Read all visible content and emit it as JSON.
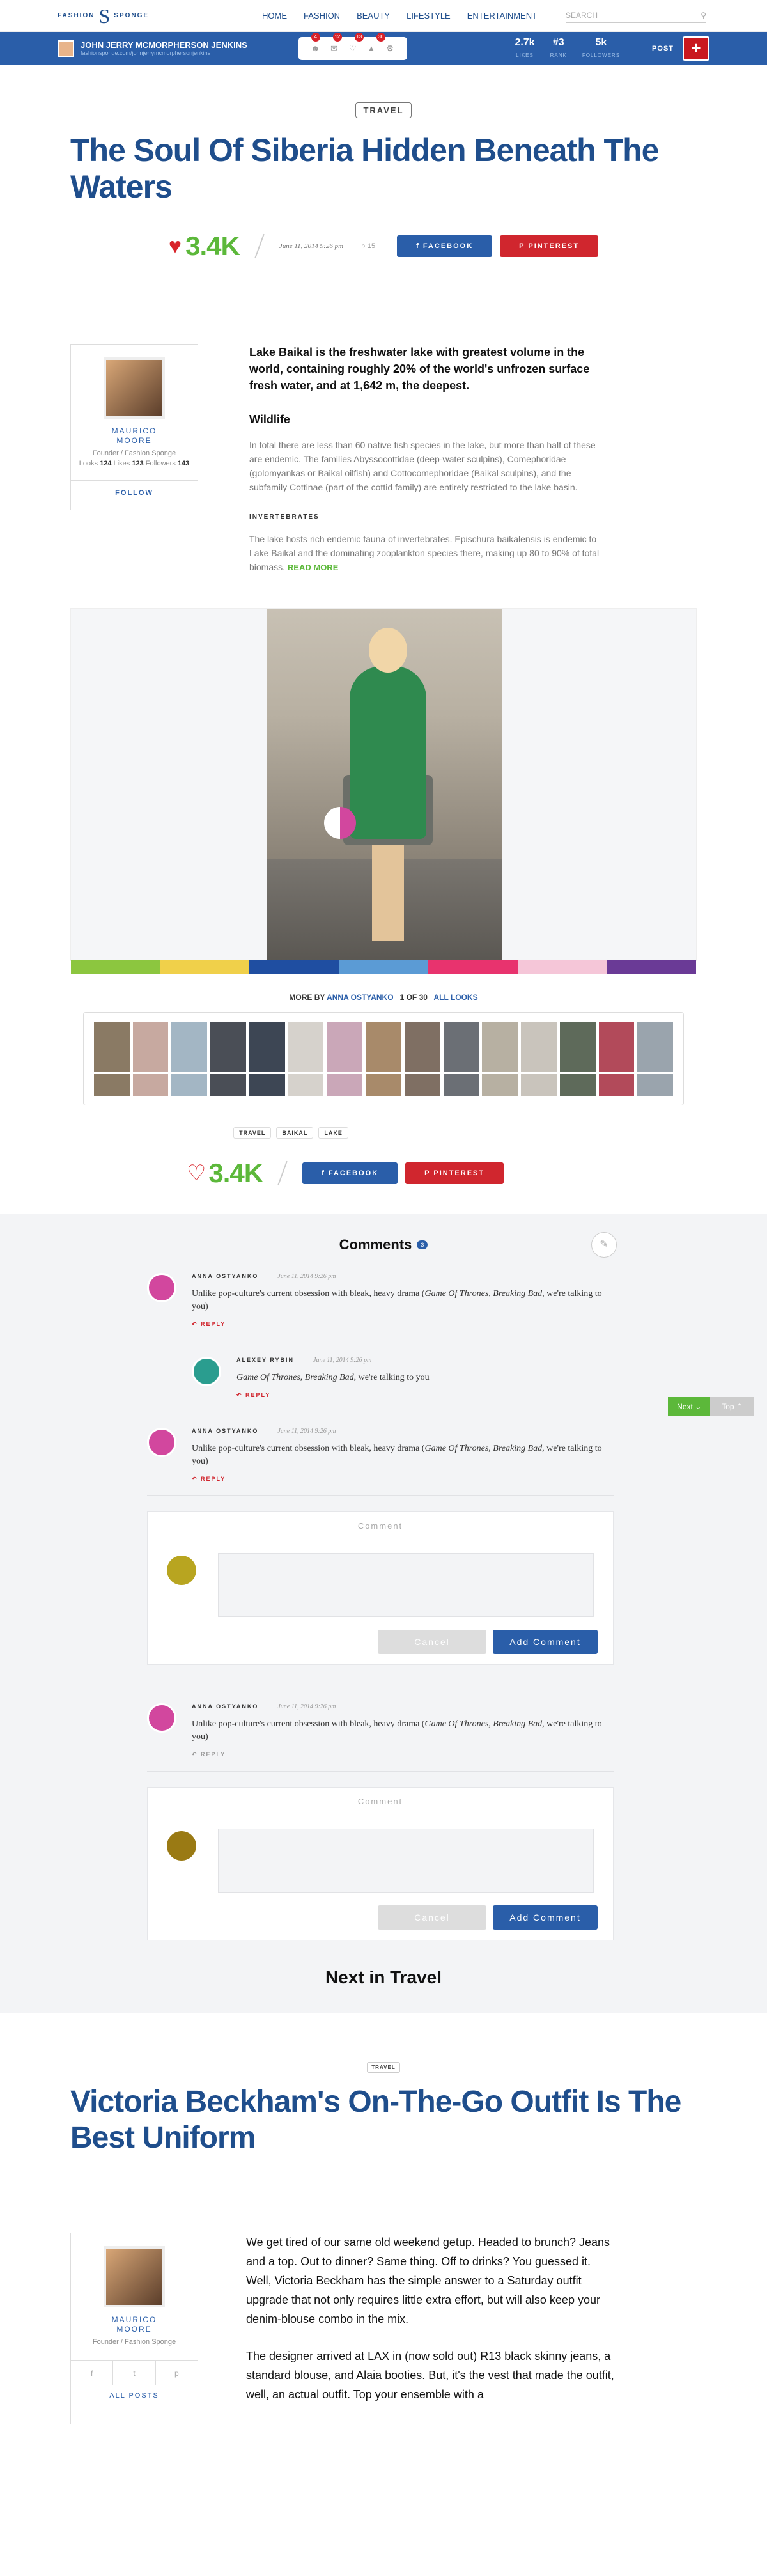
{
  "brand": {
    "left": "FASHION",
    "right": "SPONGE",
    "mark": "S"
  },
  "nav": {
    "items": [
      "HOME",
      "FASHION",
      "BEAUTY",
      "LIFESTYLE",
      "ENTERTAINMENT"
    ],
    "search_placeholder": "SEARCH"
  },
  "user": {
    "name": "JOHN JERRY MCMORPHERSON JENKINS",
    "url": "fashionsponge.com/johnjerrymcmorphersonjenkins",
    "badges": [
      "4",
      "12",
      "13",
      "30"
    ],
    "stats": [
      {
        "value": "2.7k",
        "label": "LIKES"
      },
      {
        "value": "#3",
        "label": "RANK"
      },
      {
        "value": "5k",
        "label": "FOLLOWERS"
      }
    ],
    "post_label": "POST",
    "plus": "+"
  },
  "article": {
    "category": "TRAVEL",
    "title": "The Soul Of Siberia Hidden Beneath The Waters",
    "likes": "3.4K",
    "date": "June 11, 2014 9:26 pm",
    "comment_count": "15",
    "facebook": "FACEBOOK",
    "pinterest": "PINTEREST",
    "lead": "Lake Baikal is the freshwater lake with greatest volume in the world, containing roughly 20% of the world's unfrozen surface fresh water, and at 1,642 m, the deepest.",
    "subhead": "Wildlife",
    "para1": "In total there are less than 60 native fish species in the lake, but more than half of these are endemic. The families Abyssocottidae (deep-water sculpins), Comephoridae (golomyankas or Baikal oilfish) and Cottocomephoridae (Baikal sculpins), and the subfamily Cottinae (part of the cottid family) are entirely restricted to the lake basin.",
    "smallhead": "INVERTEBRATES",
    "para2": "The lake hosts rich endemic fauna of invertebrates. Epischura baikalensis is endemic to Lake Baikal and the dominating zooplankton species there, making up 80 to 90% of total biomass.",
    "read_more": "READ MORE",
    "tags": [
      "TRAVEL",
      "BAIKAL",
      "LAKE"
    ]
  },
  "author": {
    "name_line1": "MAURICO",
    "name_line2": "MOORE",
    "role": "Founder / Fashion Sponge",
    "looks_label": "Looks",
    "looks": "124",
    "likes_label": "Likes",
    "likes": "123",
    "followers_label": "Followers",
    "followers": "143",
    "follow": "FOLLOW"
  },
  "colorbar": [
    "#8cc63f",
    "#f0d04a",
    "#1f4ea1",
    "#5b9bd5",
    "#e8336e",
    "#f5c6d8",
    "#6a3a96"
  ],
  "moreby": {
    "prefix": "MORE BY",
    "name": "ANNA OSTYANKO",
    "pos": "1 OF 30",
    "all": "ALL LOOKS"
  },
  "comments": {
    "title": "Comments",
    "count": "3",
    "items": [
      {
        "author": "ANNA OSTYANKO",
        "date": "June 11, 2014 9:26 pm",
        "text_pre": "Unlike pop-culture's current obsession with bleak, heavy drama (",
        "text_em": "Game Of Thrones, Breaking Bad",
        "text_post": ", we're talking to you)",
        "reply": "REPLY"
      },
      {
        "author": "ALEXEY RYBIN",
        "date": "June 11, 2014 9:26 pm",
        "text_pre": "",
        "text_em": "Game Of Thrones, Breaking Bad",
        "text_post": ", we're talking to you",
        "reply": "REPLY"
      },
      {
        "author": "ANNA OSTYANKO",
        "date": "June 11, 2014 9:26 pm",
        "text_pre": "Unlike pop-culture's current obsession with bleak, heavy drama (",
        "text_em": "Game Of Thrones, Breaking Bad",
        "text_post": ", we're talking to you)",
        "reply": "REPLY"
      },
      {
        "author": "ANNA OSTYANKO",
        "date": "June 11, 2014 9:26 pm",
        "text_pre": "Unlike pop-culture's current obsession with bleak, heavy drama (",
        "text_em": "Game Of Thrones, Breaking Bad",
        "text_post": ", we're talking to you)",
        "reply": "REPLY"
      }
    ],
    "box_label": "Comment",
    "cancel": "Cancel",
    "add": "Add Comment",
    "next_btn": "Next",
    "top_btn": "Top"
  },
  "next_in": "Next in Travel",
  "next_article": {
    "category": "TRAVEL",
    "title": "Victoria Beckham's On-The-Go Outfit Is The Best Uniform",
    "para1": "We get tired of our same old weekend getup. Headed to brunch? Jeans and a top. Out to dinner? Same thing. Off to drinks? You guessed it. Well, Victoria Beckham has the simple answer to a Saturday outfit upgrade that not only requires little extra effort, but will also keep your denim-blouse combo in the mix.",
    "para2": "The designer arrived at LAX in (now sold out) R13 black skinny jeans, a standard blouse, and Alaia booties. But, it's the vest that made the outfit, well, an actual outfit. Top your ensemble with a",
    "socials": [
      "f",
      "t",
      "p"
    ],
    "all_posts": "ALL POSTS"
  }
}
